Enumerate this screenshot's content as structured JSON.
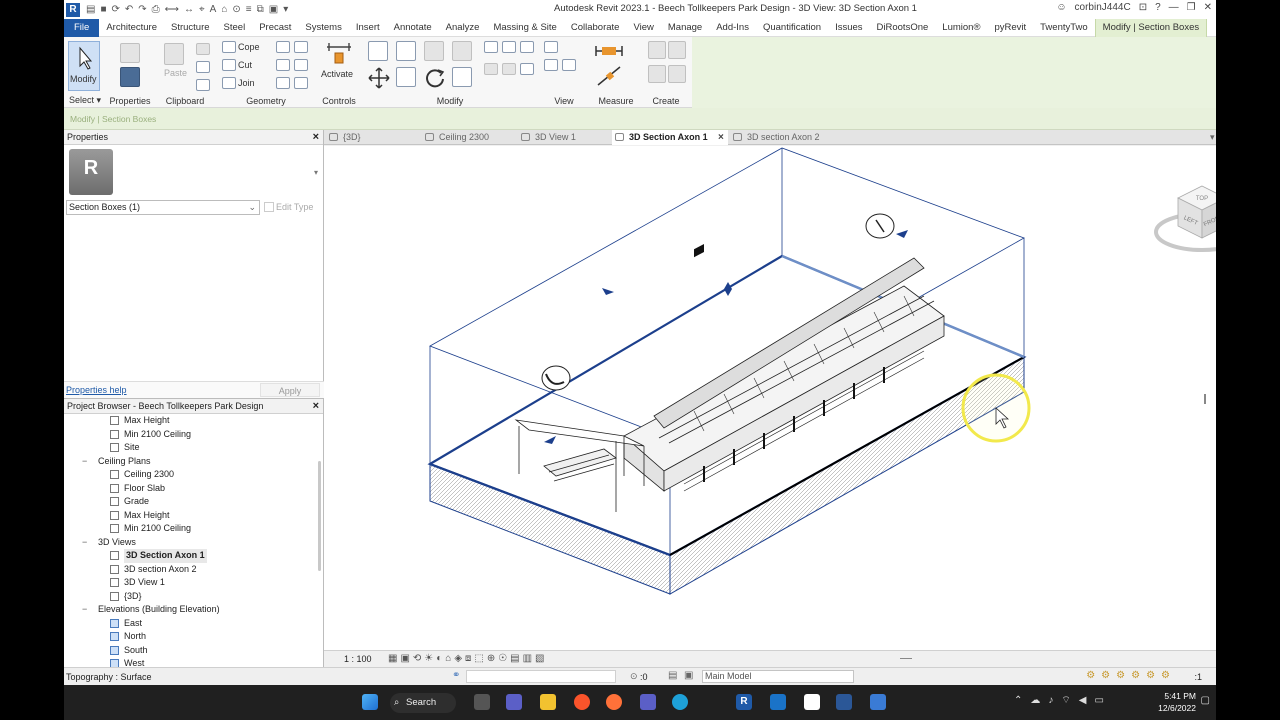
{
  "app": {
    "title": "Autodesk Revit 2023.1 - Beech Tollkeepers Park Design - 3D View: 3D Section Axon 1",
    "user": "corbinJ444C",
    "logo": "R"
  },
  "menu": {
    "tabs": [
      "File",
      "Architecture",
      "Structure",
      "Steel",
      "Precast",
      "Systems",
      "Insert",
      "Annotate",
      "Analyze",
      "Massing & Site",
      "Collaborate",
      "View",
      "Manage",
      "Add-Ins",
      "Quantification",
      "Issues",
      "DiRootsOne",
      "Lumion®",
      "pyRevit",
      "TwentyTwo",
      "Modify | Section Boxes"
    ]
  },
  "ribbon": {
    "modify_label": "Modify",
    "groups": {
      "select": "Select ▾",
      "properties": "Properties",
      "clipboard": "Clipboard",
      "geometry": "Geometry",
      "controls": "Controls",
      "modify": "Modify",
      "view": "View",
      "measure": "Measure",
      "create": "Create"
    },
    "paste": "Paste",
    "cope": "Cope",
    "cut": "Cut",
    "join": "Join",
    "activate": "Activate"
  },
  "context_bar": "Modify | Section Boxes",
  "properties": {
    "header": "Properties",
    "type_selector": "Section Boxes (1)",
    "edit_type": "Edit Type",
    "help": "Properties help",
    "apply": "Apply"
  },
  "browser": {
    "header": "Project Browser - Beech Tollkeepers Park Design",
    "rows": [
      {
        "label": "Max Height",
        "level": 2,
        "box": "white"
      },
      {
        "label": "Min 2100 Ceiling",
        "level": 2,
        "box": "white"
      },
      {
        "label": "Site",
        "level": 2,
        "box": "white"
      },
      {
        "label": "Ceiling Plans",
        "level": 1,
        "twisty": "−"
      },
      {
        "label": "Ceiling 2300",
        "level": 2,
        "box": "white"
      },
      {
        "label": "Floor Slab",
        "level": 2,
        "box": "white"
      },
      {
        "label": "Grade",
        "level": 2,
        "box": "white"
      },
      {
        "label": "Max Height",
        "level": 2,
        "box": "white"
      },
      {
        "label": "Min 2100 Ceiling",
        "level": 2,
        "box": "white"
      },
      {
        "label": "3D Views",
        "level": 1,
        "twisty": "−"
      },
      {
        "label": "3D Section Axon 1",
        "level": 2,
        "box": "white",
        "selected": true
      },
      {
        "label": "3D section Axon 2",
        "level": 2,
        "box": "white"
      },
      {
        "label": "3D View 1",
        "level": 2,
        "box": "white"
      },
      {
        "label": "{3D}",
        "level": 2,
        "box": "white"
      },
      {
        "label": "Elevations (Building Elevation)",
        "level": 1,
        "twisty": "−"
      },
      {
        "label": "East",
        "level": 2,
        "box": "blue"
      },
      {
        "label": "North",
        "level": 2,
        "box": "blue"
      },
      {
        "label": "South",
        "level": 2,
        "box": "blue"
      },
      {
        "label": "West",
        "level": 2,
        "box": "blue"
      }
    ]
  },
  "view_tabs": [
    "{3D}",
    "Ceiling 2300",
    "3D View 1",
    "3D Section Axon 1",
    "3D section Axon 2"
  ],
  "active_view_tab": 3,
  "viewcube": {
    "top": "TOP",
    "left": "LEFT",
    "front": "FRONT"
  },
  "view_control": {
    "scale": "1 : 100"
  },
  "status": {
    "text": "Topography : Surface",
    "zero": ":0",
    "model": "Main Model",
    "filter": ":1"
  },
  "taskbar": {
    "search": "Search",
    "time": "5:41 PM",
    "date": "12/6/2022"
  },
  "colors": {
    "accent": "#1f5aa8",
    "context_tab": "#e3efd2",
    "section_box_line": "#1c3f8c",
    "cursor_highlight": "#f2e94c"
  }
}
